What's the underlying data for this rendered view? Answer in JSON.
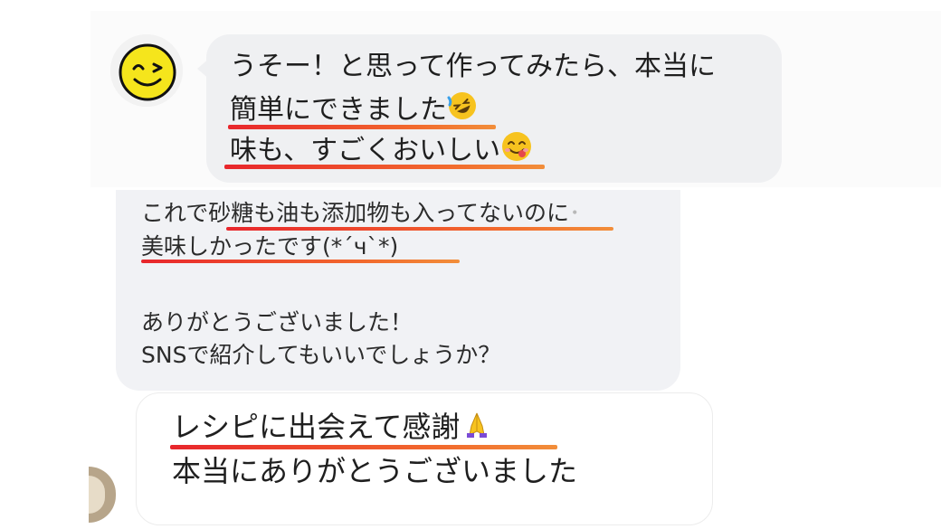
{
  "message1": {
    "line1": "うそー！と思って作ってみたら、本当に",
    "line2": "簡単にできました",
    "line2_emoji": "rolling-on-floor-laughing-emoji",
    "line3": "味も、すごくおいしい",
    "line3_emoji": "face-savoring-food-emoji"
  },
  "message2": {
    "line1a": "これで砂糖も油も添加物も入ってないのに",
    "line1_cut": "･",
    "line2": "美味しかったです(*´ч`*)",
    "line4": "ありがとうございました！",
    "line5": "SNSで紹介してもいいでしょうか？"
  },
  "message3": {
    "line1": "レシピに出会えて感謝",
    "line1_emoji": "folded-hands-emoji",
    "line2": "本当にありがとうございました"
  },
  "colors": {
    "underline_start": "#e8262c",
    "underline_end": "#f28e3a",
    "bubble_gray": "#eff0f2",
    "avatar_yellow": "#f5e51c"
  }
}
